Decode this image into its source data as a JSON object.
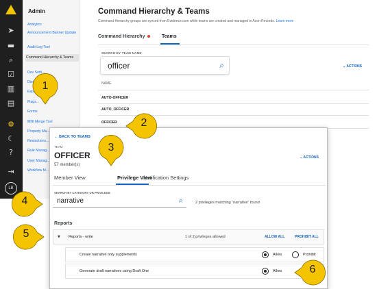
{
  "rail": {
    "icons": [
      "logo-icon",
      "send-icon",
      "folder-icon",
      "search-icon",
      "checkbox-icon",
      "chart-icon",
      "document-icon",
      "gear-icon",
      "moon-icon",
      "help-icon",
      "logout-icon"
    ],
    "avatar_initials": "LB"
  },
  "sidebar": {
    "title": "Admin",
    "items": [
      {
        "label": "Analytics"
      },
      {
        "label": "Announcement Banner Update"
      },
      {
        "label": "Audit Log Tool"
      },
      {
        "label": "Command Hierarchy & Teams"
      },
      {
        "label": "Dev Setti..."
      },
      {
        "label": "Distrib..."
      },
      {
        "label": "Expi..."
      },
      {
        "label": "Flags..."
      },
      {
        "label": "Forms"
      },
      {
        "label": "MNI Merge Tool"
      },
      {
        "label": "Property Ma..."
      },
      {
        "label": "Restrictions..."
      },
      {
        "label": "Rule Manag..."
      },
      {
        "label": "User Manag..."
      },
      {
        "label": "Workflow M..."
      }
    ]
  },
  "main": {
    "title": "Command Hierarchy & Teams",
    "subtitle": "Command Hierarchy groups are synced from Evidence.com while teams are created and managed in Axon Records.",
    "learn_more": "Learn more",
    "tabs": [
      {
        "label": "Command Hierarchy"
      },
      {
        "label": "Teams"
      }
    ],
    "search_label": "SEARCH BY TEAM NAME",
    "search_value": "officer",
    "actions_label": "ACTIONS",
    "column_header": "NAME",
    "rows": [
      "AUTO-OFFICER",
      "AUTO_OFFICER",
      "OFFICER"
    ]
  },
  "card": {
    "back_label": "BACK TO TEAMS",
    "team_label": "TEAM",
    "team_name": "OFFICER",
    "members": "57 member(s)",
    "actions_label": "ACTIONS",
    "tabs": [
      {
        "label": "Member View"
      },
      {
        "label": "Privilege View"
      },
      {
        "label": "Notification Settings"
      }
    ],
    "search_label": "SEARCH BY CATEGORY OR PRIVILEGE",
    "search_value": "narrative",
    "match_count": "2 privileges matching \"narrative\" found",
    "section_title": "Reports",
    "group": {
      "name": "Reports - write",
      "count": "1 of 2 privileges allowed",
      "allow_all": "ALLOW ALL",
      "prohibit_all": "PROHIBIT ALL"
    },
    "privileges": [
      {
        "name": "Create narrative only supplements",
        "allow": "Allow",
        "prohibit": "Prohibit",
        "selected": "allow"
      },
      {
        "name": "Generate draft narratives using Draft One",
        "allow": "Allow",
        "selected": "allow"
      }
    ]
  },
  "callouts": [
    "1",
    "2",
    "3",
    "4",
    "5",
    "6"
  ],
  "colors": {
    "accent": "#1565c0",
    "callout": "#f5c400",
    "rail": "#1f1f1f",
    "link": "#1a73e8",
    "alert_dot": "#e53935"
  }
}
